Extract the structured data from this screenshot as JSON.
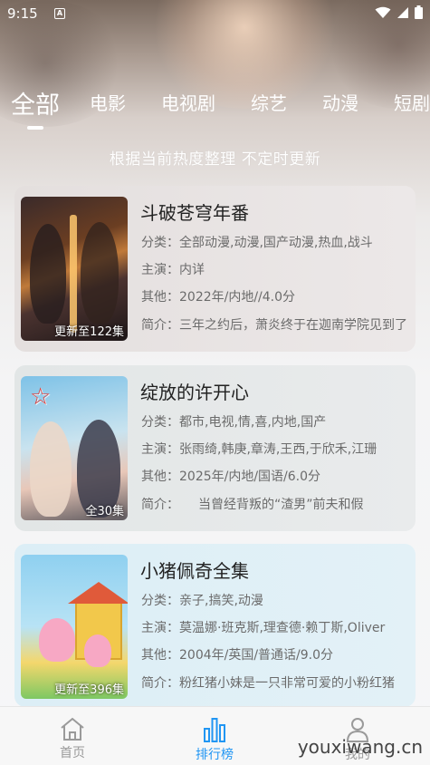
{
  "status_bar": {
    "time": "9:15"
  },
  "tabs": [
    {
      "label": "全部",
      "active": true
    },
    {
      "label": "电影"
    },
    {
      "label": "电视剧"
    },
    {
      "label": "综艺"
    },
    {
      "label": "动漫"
    },
    {
      "label": "短剧"
    }
  ],
  "subtitle": "根据当前热度整理 不定时更新",
  "items": [
    {
      "title": "斗破苍穹年番",
      "category": "分类：全部动漫,动漫,国产动漫,热血,战斗",
      "cast": "主演：内详",
      "other": "其他：2022年/内地//4.0分",
      "intro": "简介：三年之约后，萧炎终于在迦南学院见到了",
      "badge": "更新至122集"
    },
    {
      "title": "绽放的许开心",
      "category": "分类：都市,电视,情,喜,内地,国产",
      "cast": "主演：张雨绮,韩庚,章涛,王西,于欣禾,江珊",
      "other": "其他：2025年/内地/国语/6.0分",
      "intro": "简介：　　当曾经背叛的“渣男”前夫和假",
      "badge": "全30集"
    },
    {
      "title": "小猪佩奇全集",
      "category": "分类：亲子,搞笑,动漫",
      "cast": "主演：莫温娜·班克斯,理查德·赖丁斯,Oliver",
      "other": "其他：2004年/英国/普通话/9.0分",
      "intro": "简介：粉红猪小妹是一只非常可爱的小粉红猪",
      "badge": "更新至396集"
    }
  ],
  "nav": {
    "home": "首页",
    "rank": "排行榜",
    "mine": "我的"
  },
  "watermark": "youxiwang.cn",
  "colors": {
    "accent": "#2196f3",
    "inactive": "#9a9a9a"
  }
}
